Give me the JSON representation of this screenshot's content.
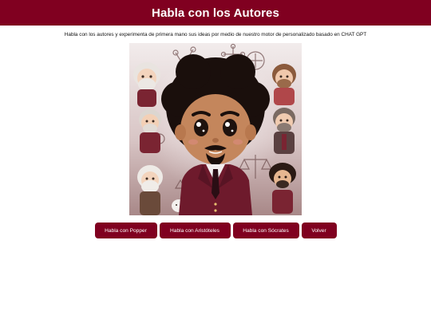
{
  "theme": {
    "brand_color": "#800020"
  },
  "header": {
    "title": "Habla con los Autores"
  },
  "intro": {
    "text": "Habla con los autores y experimenta de primera mano sus ideas por medio de nuestro motor de personalizado basado en CHAT GPT"
  },
  "hero": {
    "icon": "authors-illustration"
  },
  "actions": {
    "popper_label": "Habla con Popper",
    "aristoteles_label": "Habla con Aristóteles",
    "socrates_label": "Habla con Sócrates",
    "volver_label": "Volver"
  }
}
